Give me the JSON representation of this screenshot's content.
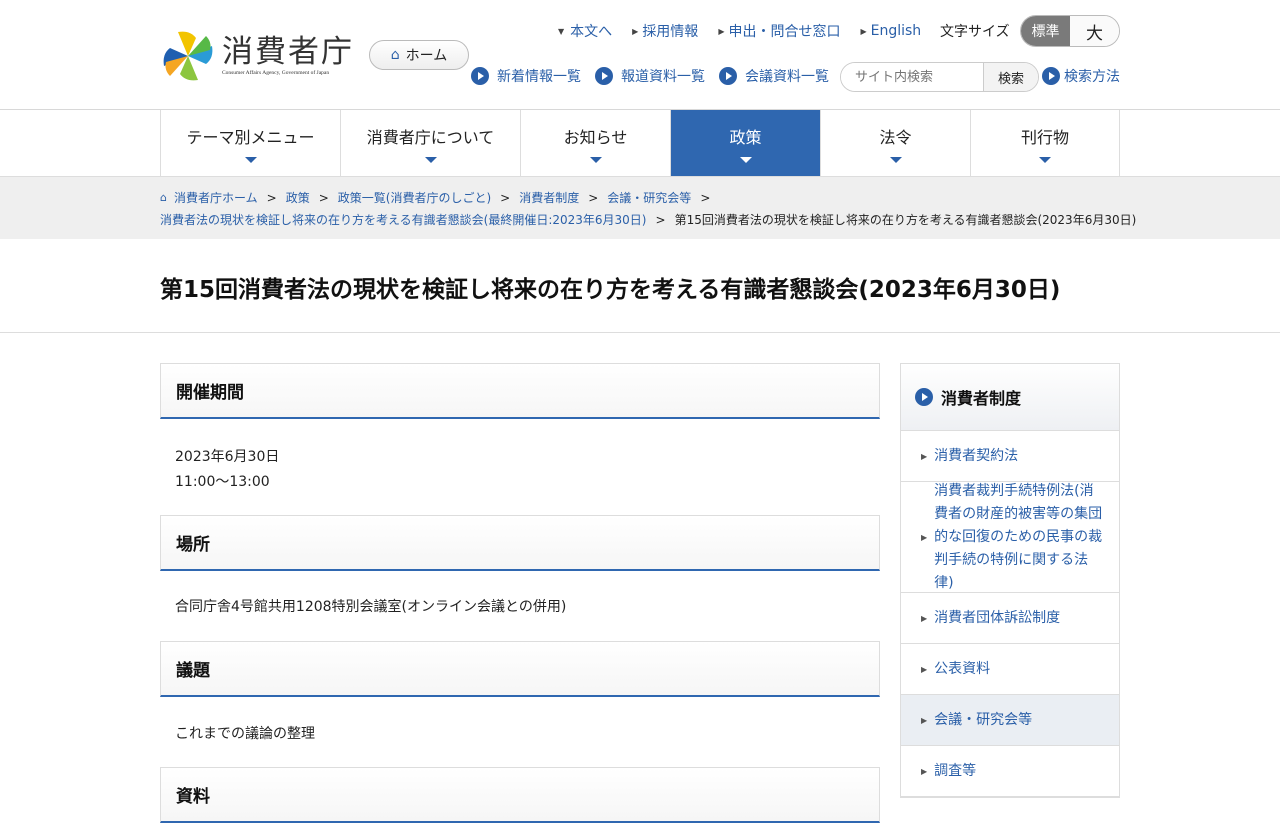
{
  "header": {
    "logo_title": "消費者庁",
    "logo_sub": "Consumer Affairs Agency, Government of Japan",
    "home_label": "ホーム",
    "top_links": [
      "本文へ",
      "採用情報",
      "申出・問合せ窓口",
      "English"
    ],
    "fontsize_label": "文字サイズ",
    "fontsize_standard": "標準",
    "fontsize_large": "大",
    "sub_links": [
      "新着情報一覧",
      "報道資料一覧",
      "会議資料一覧"
    ],
    "search_placeholder": "サイト内検索",
    "search_button": "検索",
    "search_help": "検索方法"
  },
  "nav": [
    "テーマ別メニュー",
    "消費者庁について",
    "お知らせ",
    "政策",
    "法令",
    "刊行物"
  ],
  "breadcrumb": {
    "items": [
      "消費者庁ホーム",
      "政策",
      "政策一覧(消費者庁のしごと)",
      "消費者制度",
      "会議・研究会等",
      "消費者法の現状を検証し将来の在り方を考える有識者懇談会(最終開催日:2023年6月30日)"
    ],
    "current": "第15回消費者法の現状を検証し将来の在り方を考える有識者懇談会(2023年6月30日)"
  },
  "page_title": "第15回消費者法の現状を検証し将来の在り方を考える有識者懇談会(2023年6月30日)",
  "sections": {
    "period_h": "開催期間",
    "period_date": "2023年6月30日",
    "period_time": "11:00～13:00",
    "place_h": "場所",
    "place": "合同庁舎4号館共用1208特別会議室(オンライン会議との併用)",
    "agenda_h": "議題",
    "agenda": "これまでの議論の整理",
    "materials_h": "資料"
  },
  "sidebar": {
    "title": "消費者制度",
    "items": [
      "消費者契約法",
      "消費者裁判手続特例法(消費者の財産的被害等の集団的な回復のための民事の裁判手続の特例に関する法律)",
      "消費者団体訴訟制度",
      "公表資料",
      "会議・研究会等",
      "調査等"
    ]
  },
  "colors": {
    "accent": "#2f67b0",
    "link": "#2a5fa8"
  }
}
